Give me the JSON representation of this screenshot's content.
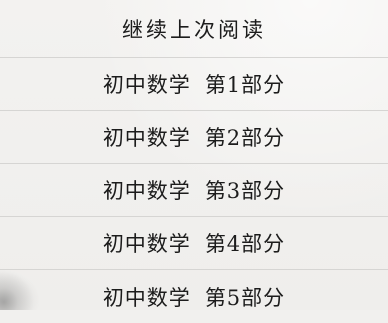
{
  "menu": {
    "continue_label": "继续上次阅读",
    "items": [
      {
        "subject": "初中数学",
        "part": "第1部分"
      },
      {
        "subject": "初中数学",
        "part": "第2部分"
      },
      {
        "subject": "初中数学",
        "part": "第3部分"
      },
      {
        "subject": "初中数学",
        "part": "第4部分"
      },
      {
        "subject": "初中数学",
        "part": "第5部分"
      }
    ]
  }
}
